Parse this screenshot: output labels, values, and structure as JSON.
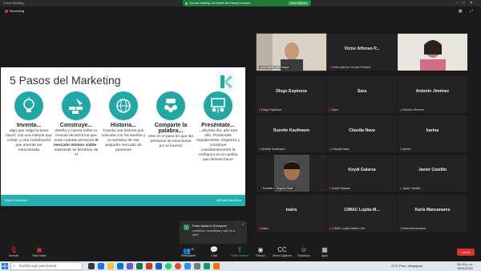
{
  "window": {
    "title": "Zoom Meeting"
  },
  "share_banner": {
    "text": "You are viewing Luis Martin del Campo's screen",
    "options_label": "View Options"
  },
  "recording": {
    "label": "Recording"
  },
  "slide": {
    "title": "5 Pasos del Marketing",
    "footer_left": "Kiatu Education",
    "footer_right": "@KiatuEducation",
    "steps": [
      {
        "title": "Inventa...",
        "desc": "algo que valga la pena hacer, con una historia que contar, y una contribución que amerite ser mencionada",
        "icon": "lightbulb-head-icon"
      },
      {
        "title": "Construye...",
        "desc_pre": "diseña y cuenta sobre tu invento de tal forma que unas cuantas personas ",
        "desc_bold": "el mercado mínimo viable",
        "desc_post": " - realmente se beneficie de él",
        "icon": "brick-trowel-icon"
      },
      {
        "title": "Historia...",
        "desc": "Cuenta una historia que coincida con los sueños y la narrativa de ese pequeño mercado de personas",
        "icon": "globe-people-icon"
      },
      {
        "title": "Comparte la palabra...",
        "desc": "este es el paso en que las personas se emocionan por tu invento",
        "icon": "group-chat-icon"
      },
      {
        "title": "Preséntate...",
        "desc": "...día tras día, año tras año. Preséntate regularmente. Organiza y construye consistentemente la confianza en el cambio que deseas hacer",
        "icon": "presentation-board-icon"
      }
    ]
  },
  "participants": [
    {
      "name": "",
      "label": "Luis Martin del Campo",
      "video": true
    },
    {
      "name": "Víctor Alfonso P...",
      "label": "Víctor Alfonso Peraza Peniche"
    },
    {
      "name": "",
      "label": "",
      "video": true
    },
    {
      "name": "Diego Espinoza",
      "label": "Diego Espinoza"
    },
    {
      "name": "Sara",
      "label": "Sara"
    },
    {
      "name": "Antonio Jiménez",
      "label": "Antonio Jiménez"
    },
    {
      "name": "Suzette Kaufmann",
      "label": "Suzette Kaufmann"
    },
    {
      "name": "Claudia Nava",
      "label": "Claudia Nava"
    },
    {
      "name": "karina",
      "label": "karina"
    },
    {
      "name": "",
      "label": "Rodolfo I. Segura Chan",
      "video": true
    },
    {
      "name": "Keydi Galarza",
      "label": "Keydi Galarza"
    },
    {
      "name": "Javier Castillo",
      "label": "Javier Castillo"
    },
    {
      "name": "Isaira",
      "label": "isaira"
    },
    {
      "name": "CIMAC Lupita M...",
      "label": "CIMAC Lupita Martín Cob"
    },
    {
      "name": "Karla Manzanares",
      "label": "Karla Manzanares"
    }
  ],
  "chat_popup": {
    "from": "From Isaira to Everyone",
    "message": "confianza, mutualidad y qué es la otra?"
  },
  "toolbar": {
    "unmute": "Unmute",
    "start_video": "Start Video",
    "participants": "Participants",
    "participants_count": "15",
    "chat": "Chat",
    "share_screen": "Share Screen",
    "record": "Record",
    "show_captions": "Show Captions",
    "reactions": "Reactions",
    "apps": "Apps",
    "leave": "Leave"
  },
  "taskbar": {
    "search_placeholder": "Escribe aquí para buscar",
    "weather": "27°C  Prec. despejado",
    "time": "06:43 p. m.",
    "date": "28/11/2022"
  },
  "colors": {
    "teal": "#1fa8a6",
    "leave_red": "#e0312b",
    "share_green": "#1f7a3a"
  }
}
